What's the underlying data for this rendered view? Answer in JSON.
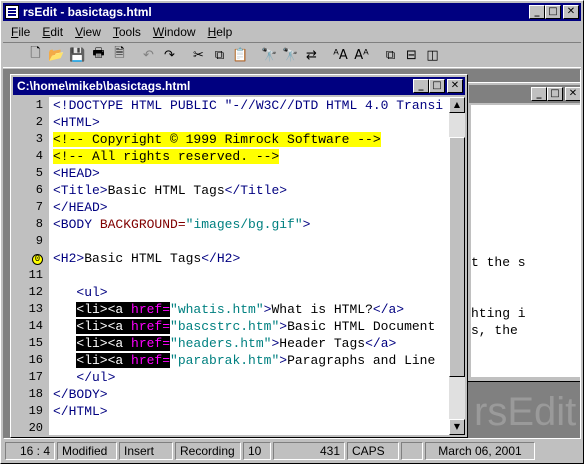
{
  "app": {
    "title": "rsEdit - basictags.html"
  },
  "menu": [
    "File",
    "Edit",
    "View",
    "Tools",
    "Window",
    "Help"
  ],
  "toolbar": {
    "buttons": [
      {
        "name": "new-file-icon",
        "glyph": "🗋"
      },
      {
        "name": "open-folder-icon",
        "glyph": "📂"
      },
      {
        "name": "save-icon",
        "glyph": "💾"
      },
      {
        "name": "print-icon",
        "glyph": "🖶"
      },
      {
        "name": "print-preview-icon",
        "glyph": "🗎"
      },
      {
        "name": "undo-icon",
        "glyph": "↶",
        "disabled": true
      },
      {
        "name": "redo-icon",
        "glyph": "↷"
      },
      {
        "name": "cut-icon",
        "glyph": "✂"
      },
      {
        "name": "copy-icon",
        "glyph": "⧉"
      },
      {
        "name": "paste-icon",
        "glyph": "📋"
      },
      {
        "name": "find-icon",
        "glyph": "🔭"
      },
      {
        "name": "find-next-icon",
        "glyph": "🔭"
      },
      {
        "name": "replace-icon",
        "glyph": "⇄"
      },
      {
        "name": "font-smaller-icon",
        "glyph": "ᴬA"
      },
      {
        "name": "font-larger-icon",
        "glyph": "Aᴬ"
      },
      {
        "name": "cascade-windows-icon",
        "glyph": "⧉"
      },
      {
        "name": "tile-horizontal-icon",
        "glyph": "⊟"
      },
      {
        "name": "tile-vertical-icon",
        "glyph": "◫"
      }
    ]
  },
  "document": {
    "title": "C:\\home\\mikeb\\basictags.html",
    "line_numbers": [
      "1",
      "2",
      "3",
      "4",
      "5",
      "6",
      "7",
      "8",
      "9",
      "0",
      "11",
      "12",
      "13",
      "14",
      "15",
      "16",
      "17",
      "18",
      "19",
      "20"
    ],
    "lines": [
      [
        {
          "t": "<!DOCTYPE HTML PUBLIC \"-//W3C//DTD HTML 4.0 Transi",
          "c": "tg"
        }
      ],
      [
        {
          "t": "<HTML>",
          "c": "tg"
        }
      ],
      [
        {
          "t": "<!-- Copyright © 1999 Rimrock Software -->",
          "c": "cm"
        }
      ],
      [
        {
          "t": "<!-- All rights reserved. -->",
          "c": "cm"
        }
      ],
      [
        {
          "t": "<HEAD>",
          "c": "tg"
        }
      ],
      [
        {
          "t": "<Title>",
          "c": "tg"
        },
        {
          "t": "Basic HTML Tags",
          "c": "tx"
        },
        {
          "t": "</Title>",
          "c": "tg"
        }
      ],
      [
        {
          "t": "</HEAD>",
          "c": "tg"
        }
      ],
      [
        {
          "t": "<BODY ",
          "c": "tg"
        },
        {
          "t": "BACKGROUND=",
          "c": "at"
        },
        {
          "t": "\"images/bg.gif\"",
          "c": "av"
        },
        {
          "t": ">",
          "c": "tg"
        }
      ],
      [],
      [
        {
          "t": "<H2>",
          "c": "tg"
        },
        {
          "t": "Basic HTML Tags",
          "c": "tx"
        },
        {
          "t": "</H2>",
          "c": "tg"
        }
      ],
      [],
      [
        {
          "t": "   <ul>",
          "c": "tg"
        }
      ],
      [
        {
          "t": "   ",
          "c": "tx"
        },
        {
          "t": "<li><a ",
          "c": "hl"
        },
        {
          "t": "href=",
          "c": "hlv"
        },
        {
          "t": "\"whatis.htm\"",
          "c": "av"
        },
        {
          "t": ">",
          "c": "tg"
        },
        {
          "t": "What is HTML?",
          "c": "tx"
        },
        {
          "t": "</a>",
          "c": "tg"
        }
      ],
      [
        {
          "t": "   ",
          "c": "tx"
        },
        {
          "t": "<li><a ",
          "c": "hl"
        },
        {
          "t": "href=",
          "c": "hlv"
        },
        {
          "t": "\"bascstrc.htm\"",
          "c": "av"
        },
        {
          "t": ">",
          "c": "tg"
        },
        {
          "t": "Basic HTML Document",
          "c": "tx"
        }
      ],
      [
        {
          "t": "   ",
          "c": "tx"
        },
        {
          "t": "<li><a ",
          "c": "hl"
        },
        {
          "t": "href=",
          "c": "hlv"
        },
        {
          "t": "\"headers.htm\"",
          "c": "av"
        },
        {
          "t": ">",
          "c": "tg"
        },
        {
          "t": "Header Tags",
          "c": "tx"
        },
        {
          "t": "</a>",
          "c": "tg"
        }
      ],
      [
        {
          "t": "   ",
          "c": "tx"
        },
        {
          "t": "<li><a ",
          "c": "hl"
        },
        {
          "t": "href=",
          "c": "hlv"
        },
        {
          "t": "\"parabrak.htm\"",
          "c": "av"
        },
        {
          "t": ">",
          "c": "tg"
        },
        {
          "t": "Paragraphs and Line",
          "c": "tx"
        }
      ],
      [
        {
          "t": "   </ul>",
          "c": "tg"
        }
      ],
      [
        {
          "t": "</BODY>",
          "c": "tg"
        }
      ],
      [
        {
          "t": "</HTML>",
          "c": "tg"
        }
      ],
      []
    ]
  },
  "background_window": {
    "lines": [
      "t the s",
      "hting i",
      "s, the"
    ]
  },
  "watermark": "rsEdit",
  "status": [
    "16 : 4",
    "Modified",
    "Insert",
    "Recording",
    "10",
    "431",
    "CAPS",
    "",
    "March 06, 2001"
  ]
}
